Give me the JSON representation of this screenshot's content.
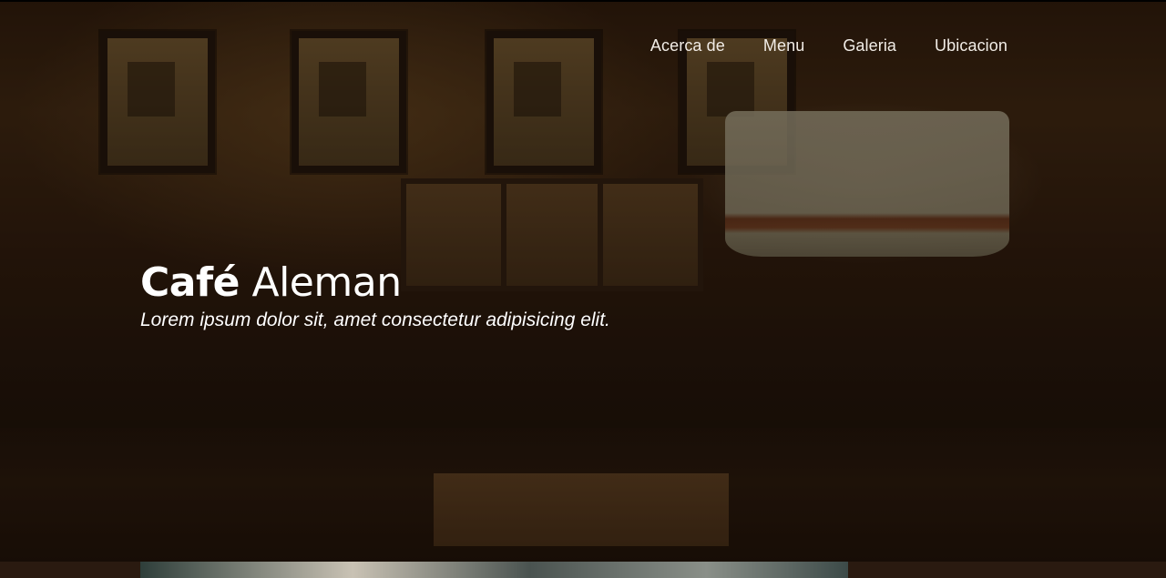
{
  "nav": {
    "items": [
      {
        "label": "Acerca de"
      },
      {
        "label": "Menu"
      },
      {
        "label": "Galeria"
      },
      {
        "label": "Ubicacion"
      }
    ]
  },
  "hero": {
    "title_strong": "Café",
    "title_rest": "Aleman",
    "subtitle": "Lorem ipsum dolor sit, amet consectetur adipisicing elit."
  },
  "colors": {
    "text": "#ffffff",
    "background": "#1a0f08"
  }
}
